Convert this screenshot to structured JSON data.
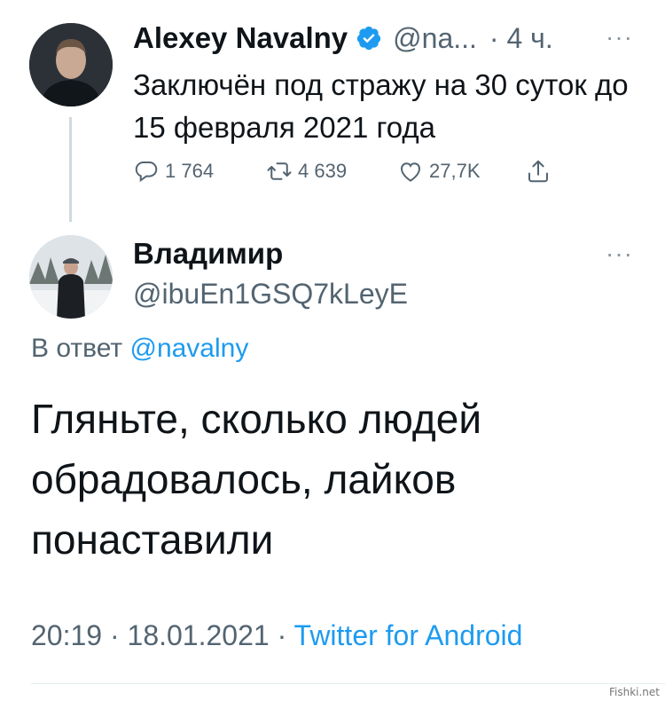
{
  "parent_tweet": {
    "author_name": "Alexey Navalny",
    "handle": "@na...",
    "time": "· 4 ч.",
    "text": "Заключён под стражу на 30 суток до 15 февраля 2021 года",
    "replies": "1 764",
    "retweets": "4 639",
    "likes": "27,7K",
    "more": "···"
  },
  "reply_tweet": {
    "author_name": "Владимир",
    "handle": "@ibuEn1GSQ7kLeyE",
    "reply_prefix": "В ответ",
    "reply_mention": "@navalny",
    "text": "Гляньте, сколько людей обрадовалось, лайков понаставили",
    "time": "20:19",
    "date": "18.01.2021",
    "separator": "·",
    "source": "Twitter for Android",
    "more": "···"
  },
  "watermark": "Fishki.net",
  "colors": {
    "accent": "#1d9bf0",
    "muted": "#536471",
    "text": "#0f1419"
  },
  "icons": [
    "reply-icon",
    "retweet-icon",
    "like-icon",
    "share-icon",
    "verified-badge-icon",
    "more-icon"
  ]
}
